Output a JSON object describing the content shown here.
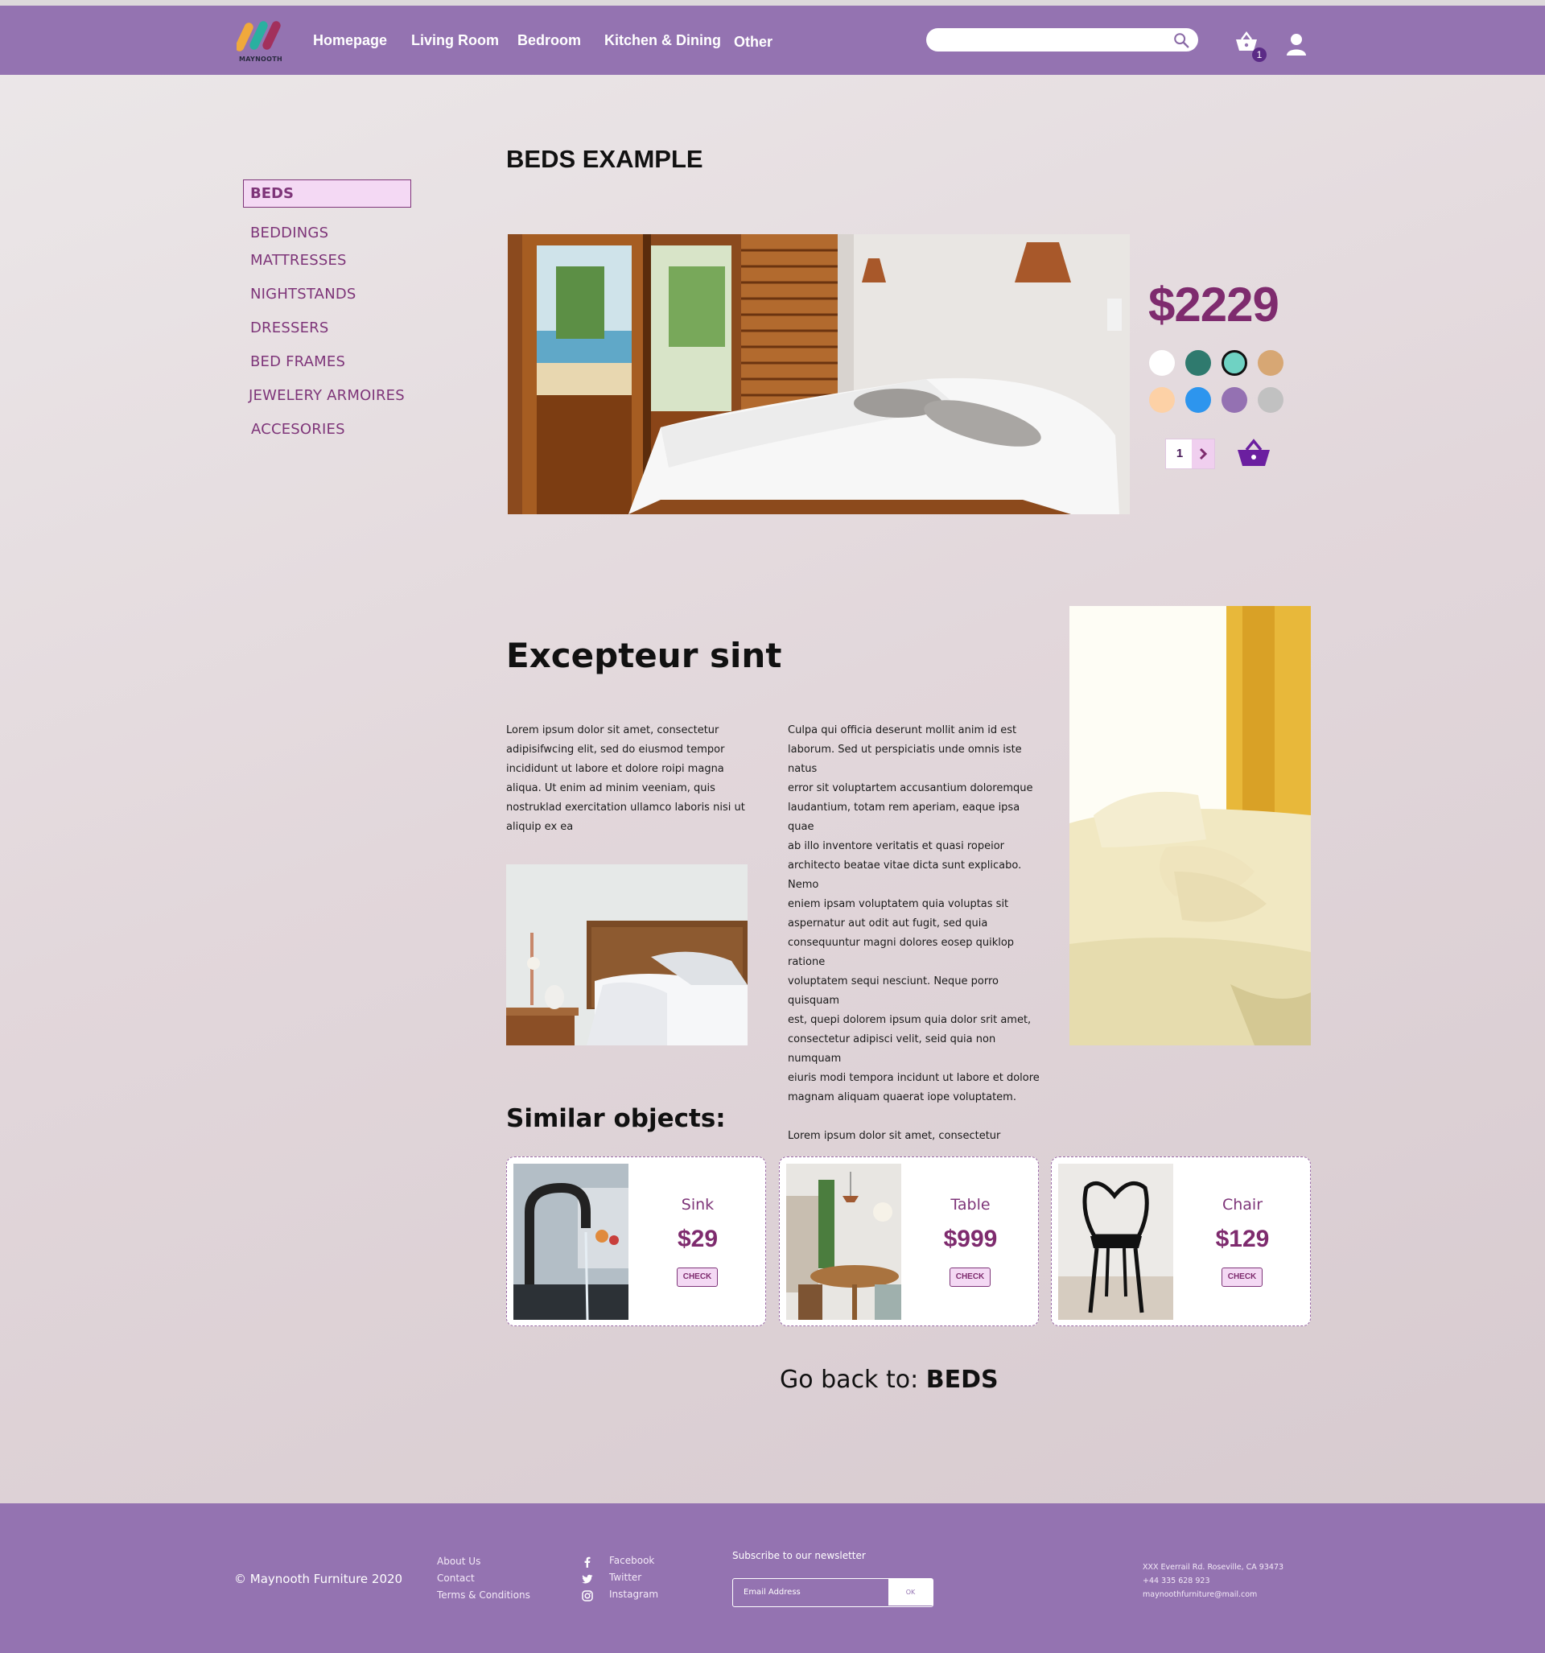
{
  "brand": {
    "logo_text": "MAYNOOTH"
  },
  "nav": {
    "links": [
      "Homepage",
      "Living Room",
      "Bedroom",
      "Kitchen & Dining",
      "Other"
    ],
    "search_value": "",
    "cart_count": "1"
  },
  "sidebar": {
    "active": "BEDS",
    "items": [
      "BEDDINGS",
      "MATTRESSES",
      "NIGHTSTANDS",
      "DRESSERS",
      "BED FRAMES",
      "JEWELERY ARMOIRES",
      "ACCESORIES"
    ]
  },
  "product": {
    "title": "BEDS EXAMPLE",
    "price": "$2229",
    "quantity": "1",
    "colors": [
      "#ffffff",
      "#2f7a6e",
      "#6fd2c3",
      "#d7a774",
      "#fdd1a6",
      "#2d95ee",
      "#9471b2",
      "#c1c1c1"
    ],
    "selected_color": "#6fd2c3"
  },
  "content": {
    "heading": "Excepteur sint",
    "paragraph_left": "Lorem ipsum dolor sit amet, consectetur adipisifwcing elit, sed do eiusmod tempor incididunt ut labore et dolore roipi magna aliqua. Ut enim ad minim veeniam, quis nostruklad exercitation ullamco laboris nisi ut aliquip ex ea",
    "paragraph_right_lines": [
      "Culpa qui officia deserunt mollit anim id est",
      "laborum. Sed ut perspiciatis unde omnis iste natus",
      "error sit voluptartem accusantium doloremque",
      "laudantium, totam rem aperiam, eaque ipsa quae",
      "ab illo inventore veritatis et quasi ropeior",
      "architecto beatae vitae dicta sunt explicabo. Nemo",
      "eniem ipsam voluptatem quia voluptas sit",
      "aspernatur aut odit aut fugit, sed quia",
      "consequuntur magni dolores eosep quiklop ratione",
      "voluptatem sequi nesciunt. Neque porro quisquam",
      "est, quepi dolorem ipsum quia dolor srit amet,",
      "consectetur adipisci velit, seid quia non numquam",
      "eiuris modi tempora incidunt ut labore et dolore",
      "magnam aliquam quaerat iope voluptatem."
    ],
    "paragraph_right_extra": "Lorem ipsum dolor sit amet, consectetur"
  },
  "similar": {
    "heading": "Similar objects:",
    "items": [
      {
        "name": "Sink",
        "price": "$29",
        "button": "CHECK"
      },
      {
        "name": "Table",
        "price": "$999",
        "button": "CHECK"
      },
      {
        "name": "Chair",
        "price": "$129",
        "button": "CHECK"
      }
    ]
  },
  "go_back": {
    "prefix": "Go back to: ",
    "target": "BEDS"
  },
  "footer": {
    "copyright": "© Maynooth Furniture 2020",
    "links": [
      "About Us",
      "Contact",
      "Terms & Conditions"
    ],
    "social": [
      "Facebook",
      "Twitter",
      "Instagram"
    ],
    "newsletter_label": "Subscribe to our newsletter",
    "email_placeholder": "Email Address",
    "ok_label": "OK",
    "address_lines": [
      "XXX Everrail Rd. Roseville, CA 93473",
      "+44 335 628 923",
      "maynoothfurniture@mail.com"
    ]
  }
}
